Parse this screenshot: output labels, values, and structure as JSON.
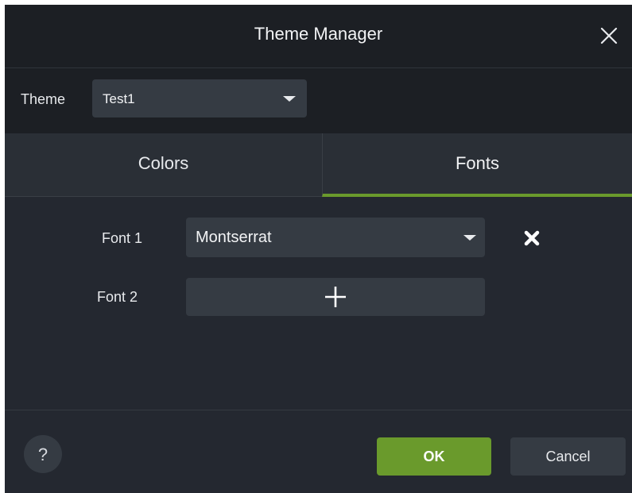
{
  "dialog": {
    "title": "Theme Manager",
    "close_icon": "close-icon"
  },
  "theme": {
    "label": "Theme",
    "selected": "Test1",
    "caret_icon": "caret-down-icon"
  },
  "tabs": [
    {
      "label": "Colors",
      "active": false
    },
    {
      "label": "Fonts",
      "active": true
    }
  ],
  "fonts": {
    "font1": {
      "label": "Font 1",
      "value": "Montserrat",
      "caret_icon": "caret-down-icon",
      "remove_icon": "remove-x-icon"
    },
    "font2": {
      "label": "Font 2",
      "add_icon": "plus-icon"
    }
  },
  "footer": {
    "help_label": "?",
    "ok_label": "OK",
    "cancel_label": "Cancel"
  },
  "colors": {
    "accent": "#6a9a2c",
    "background": "#242830",
    "header_background": "#1c1f24",
    "control_background": "#353b43"
  }
}
